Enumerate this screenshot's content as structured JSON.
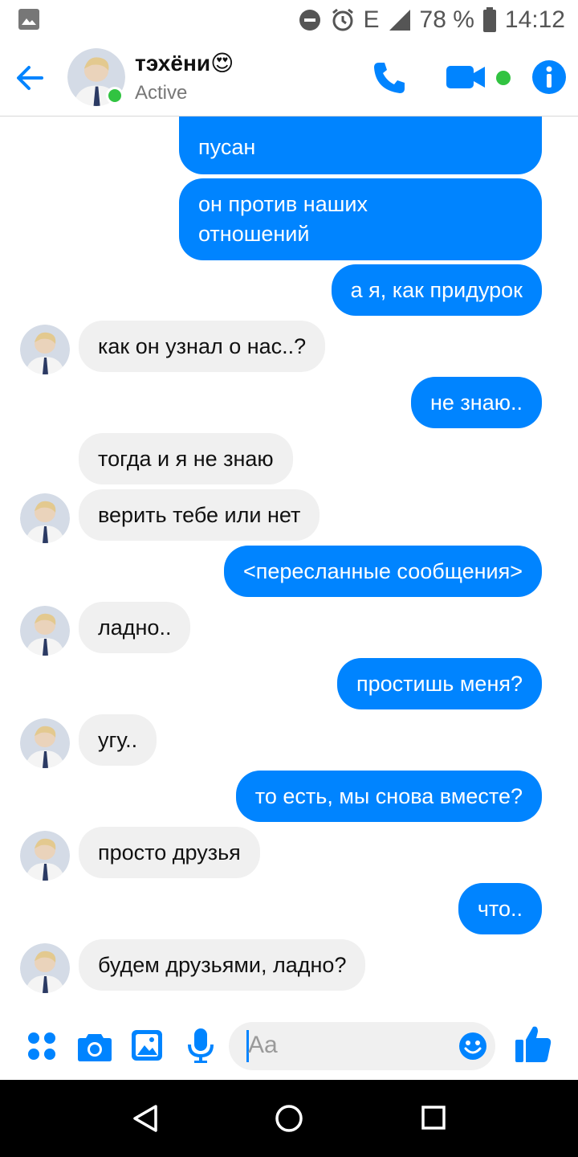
{
  "status_bar": {
    "network": "E",
    "battery": "78 %",
    "time": "14:12"
  },
  "header": {
    "contact_name": "тэхёни😍",
    "status": "Active"
  },
  "messages": [
    {
      "dir": "out",
      "text": "пусан"
    },
    {
      "dir": "out",
      "text": "он против наших\nотношений"
    },
    {
      "dir": "out",
      "text": "а я, как придурок"
    },
    {
      "dir": "in",
      "text": "как он узнал о нас..?"
    },
    {
      "dir": "out",
      "text": "не знаю.."
    },
    {
      "dir": "in",
      "text": "тогда и я не знаю"
    },
    {
      "dir": "in",
      "text": "верить тебе или нет"
    },
    {
      "dir": "out",
      "text": "<пересланные сообщения>"
    },
    {
      "dir": "in",
      "text": "ладно.."
    },
    {
      "dir": "out",
      "text": "простишь меня?"
    },
    {
      "dir": "in",
      "text": "угу.."
    },
    {
      "dir": "out",
      "text": "то есть, мы снова вместе?"
    },
    {
      "dir": "in",
      "text": "просто друзья"
    },
    {
      "dir": "out",
      "text": "что.."
    },
    {
      "dir": "in",
      "text": "будем друзьями, ладно?"
    }
  ],
  "composer": {
    "placeholder": "Aa"
  },
  "colors": {
    "accent": "#0084ff",
    "incoming_bubble": "#f0f0f0",
    "online": "#31c341"
  },
  "icons": {
    "header": [
      "back-arrow-icon",
      "phone-icon",
      "video-camera-icon",
      "info-icon"
    ],
    "composer": [
      "apps-icon",
      "camera-icon",
      "gallery-icon",
      "microphone-icon",
      "emoji-icon",
      "thumbs-up-icon"
    ],
    "nav": [
      "back-triangle-icon",
      "home-circle-icon",
      "recents-square-icon"
    ]
  }
}
